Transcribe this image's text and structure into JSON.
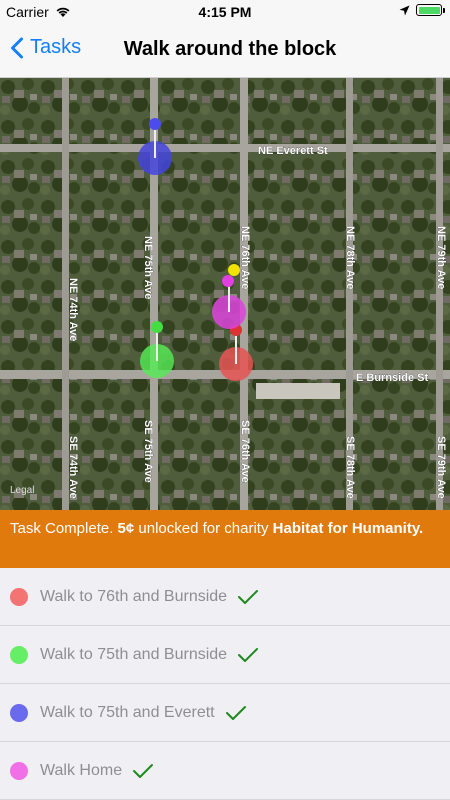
{
  "status_bar": {
    "carrier": "Carrier",
    "time": "4:15 PM"
  },
  "nav": {
    "back_label": "Tasks",
    "title": "Walk around the block"
  },
  "map": {
    "legal": "Legal",
    "streets": {
      "ne_everett": "NE Everett St",
      "e_burnside": "E Burnside St",
      "ne_74th": "NE 74th Ave",
      "ne_75th": "NE 75th Ave",
      "ne_76th": "NE 76th Ave",
      "ne_78th": "NE 78th Ave",
      "ne_79th": "NE 79th Ave",
      "se_74th": "SE 74th Ave",
      "se_75th": "SE 75th Ave",
      "se_76th": "SE 76th Ave",
      "se_78th": "SE 78th Ave",
      "se_79th": "SE 79th Ave"
    }
  },
  "banner": {
    "prefix": "Task Complete.",
    "amount": "5¢",
    "middle": "unlocked for charity",
    "charity": "Habitat for Humanity."
  },
  "tasks": [
    {
      "label": "Walk to 76th and Burnside",
      "color": "#f47373",
      "completed": true
    },
    {
      "label": "Walk to 75th and Burnside",
      "color": "#66ee66",
      "completed": true
    },
    {
      "label": "Walk to 75th and Everett",
      "color": "#6a6aee",
      "completed": true
    },
    {
      "label": "Walk Home",
      "color": "#f070e8",
      "completed": true
    }
  ],
  "colors": {
    "accent": "#147efb",
    "banner": "#e07a0d",
    "check": "#1e8a1e"
  }
}
